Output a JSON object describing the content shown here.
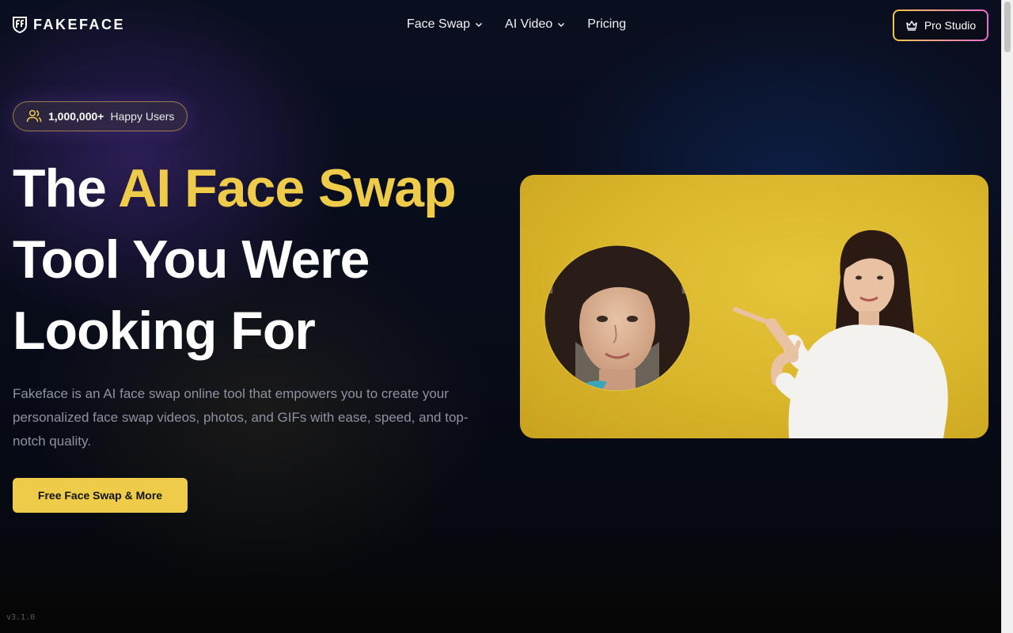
{
  "header": {
    "logo_text": "FAKEFACE",
    "nav": [
      {
        "label": "Face Swap",
        "has_dropdown": true
      },
      {
        "label": "AI Video",
        "has_dropdown": true
      },
      {
        "label": "Pricing",
        "has_dropdown": false
      }
    ],
    "pro_button": {
      "label": "Pro Studio",
      "icon": "crown-icon"
    }
  },
  "hero": {
    "badge": {
      "count": "1,000,000+",
      "label": "Happy Users",
      "icon": "users-icon"
    },
    "title": {
      "part1": "The ",
      "accent": "AI Face Swap",
      "part2": "Tool You Were",
      "part3": "Looking For"
    },
    "description": "Fakeface is an AI face swap online tool that empowers you to create your personalized face swap videos, photos, and GIFs with ease, speed, and top-notch quality.",
    "cta_label": "Free Face Swap & More"
  },
  "footer": {
    "version": "v3.1.0"
  },
  "colors": {
    "accent_yellow": "#efcb4a",
    "background": "#060a16",
    "pro_border_start": "#f2c94c",
    "pro_border_end": "#e96bd0",
    "description_text": "#8d92a0"
  }
}
